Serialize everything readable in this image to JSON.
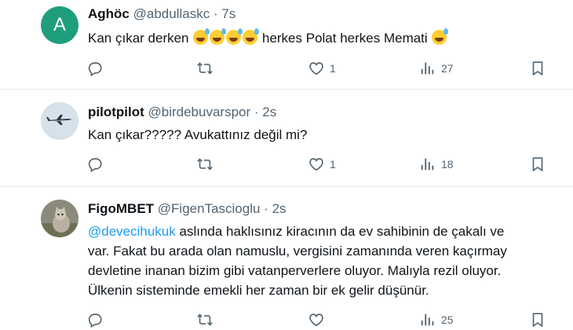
{
  "tweets": [
    {
      "avatar_letter": "A",
      "name": "Aghöc",
      "handle": "@abdullaskc",
      "separator": "·",
      "time": "7s",
      "text_a": "Kan çıkar derken",
      "text_b": "herkes Polat herkes Memati",
      "likes": "1",
      "views": "27"
    },
    {
      "name": "pilotpilot",
      "handle": "@birdebuvarspor",
      "separator": "·",
      "time": "2s",
      "text": "Kan çıkar????? Avukattınız değil mi?",
      "likes": "1",
      "views": "18"
    },
    {
      "name": "FigoMBET",
      "handle": "@FigenTascioglu",
      "separator": "·",
      "time": "2s",
      "mention": "@devecihukuk",
      "line1": " aslında haklısınız kiracının da ev sahibinin de çakalı ve",
      "line2": "var. Fakat bu arada olan namuslu, vergisini zamanında veren kaçırmay",
      "line3": "devletine inanan bizim gibi vatanperverlere oluyor. Malıyla rezil oluyor.",
      "line4": "Ülkenin sisteminde emekli her zaman bir ek gelir düşünür.",
      "views": "25"
    }
  ],
  "colors": {
    "accent": "#1d9bf0",
    "secondary_text": "#536471",
    "avatar_a": "#1f9e7e"
  },
  "icons": [
    "reply-icon",
    "retweet-icon",
    "like-icon",
    "views-icon",
    "bookmark-icon"
  ]
}
